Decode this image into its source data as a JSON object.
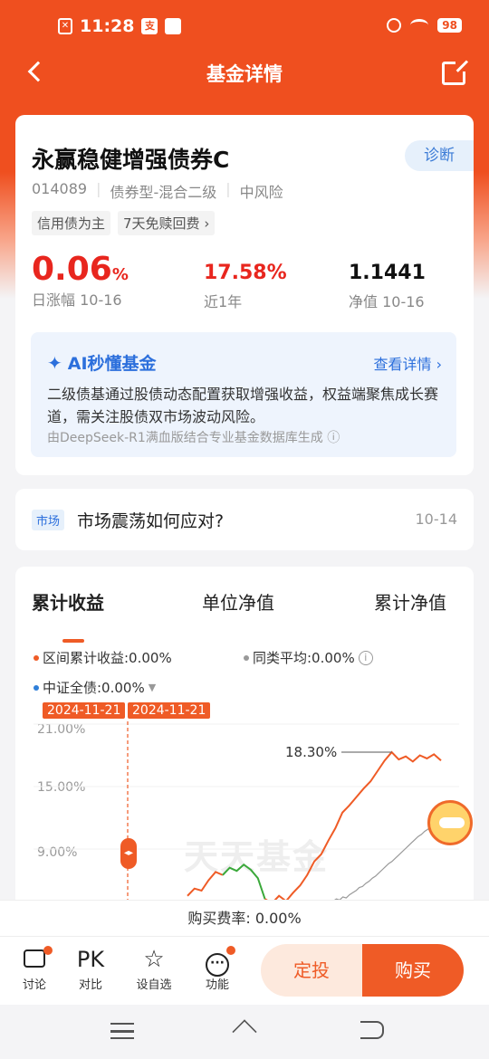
{
  "status_bar": {
    "time": "11:28",
    "battery": "98"
  },
  "header": {
    "title": "基金详情"
  },
  "fund": {
    "name": "永赢稳健增强债券C",
    "diagnose_label": "诊断",
    "code": "014089",
    "type": "债券型-混合二级",
    "risk": "中风险",
    "tags": [
      "信用债为主",
      "7天免赎回费 ›"
    ],
    "daily_change": {
      "value": "0.06",
      "unit": "%",
      "label": "日涨幅  10-16"
    },
    "year_return": {
      "value": "17.58%",
      "label": "近1年"
    },
    "nav": {
      "value": "1.1441",
      "label": "净值  10-16"
    }
  },
  "ai": {
    "title": "AI秒懂基金",
    "link": "查看详情 ›",
    "text": "二级债基通过股债动态配置获取增强收益，权益端聚焦成长赛道，需关注股债双市场波动风险。",
    "note": "由DeepSeek-R1满血版结合专业基金数据库生成 ⓘ"
  },
  "market": {
    "tag": "市场",
    "title": "市场震荡如何应对?",
    "date": "10-14"
  },
  "chart": {
    "tabs": [
      "累计收益",
      "单位净值",
      "累计净值"
    ],
    "legend": {
      "series1": "区间累计收益:0.00%",
      "peer": "同类平均:0.00%",
      "index": "中证全债:0.00%"
    },
    "date_badges": [
      "2024-11-21",
      "2024-11-21"
    ],
    "y_labels": [
      "21.00%",
      "15.00%",
      "9.00%"
    ],
    "peak_label": "18.30%",
    "watermark": "天天基金",
    "colors": {
      "fund": "#ef5b26",
      "peer": "#999999",
      "index": "#2f7fd9",
      "down": "#3aa83a"
    }
  },
  "chart_data": {
    "type": "line",
    "ylim": [
      3,
      21
    ],
    "series": [
      {
        "name": "区间累计收益",
        "values": [
          4.5,
          5.2,
          5.0,
          6.0,
          6.8,
          6.5,
          7.2,
          6.9,
          7.5,
          7.0,
          6.2,
          4.2,
          3.8,
          4.5,
          4.0,
          4.8,
          5.5,
          6.5,
          7.8,
          8.5,
          9.8,
          11.0,
          12.5,
          13.2,
          14.0,
          14.8,
          15.5,
          16.5,
          17.5,
          18.3,
          17.6,
          17.9,
          17.4,
          18.0,
          17.7,
          18.1,
          17.5
        ]
      },
      {
        "name": "同类平均",
        "values": [
          3.0,
          3.1,
          3.0,
          3.2,
          3.4,
          3.3,
          3.6,
          3.5,
          3.8,
          4.0,
          4.2,
          4.5,
          4.6,
          4.9,
          5.1,
          5.4,
          5.6,
          5.9,
          6.2,
          6.5,
          6.8,
          7.0,
          7.3,
          7.6,
          7.9,
          8.2,
          8.5,
          8.8,
          9.1,
          9.4,
          9.6,
          9.9,
          10.1,
          10.4,
          10.6,
          10.9,
          11.1
        ]
      }
    ]
  },
  "fee": {
    "text": "购买费率: 0.00%"
  },
  "bottom": {
    "discuss": "讨论",
    "pk_icon": "PK",
    "pk": "对比",
    "fav": "设自选",
    "func": "功能",
    "dingtou": "定投",
    "buy": "购买"
  }
}
